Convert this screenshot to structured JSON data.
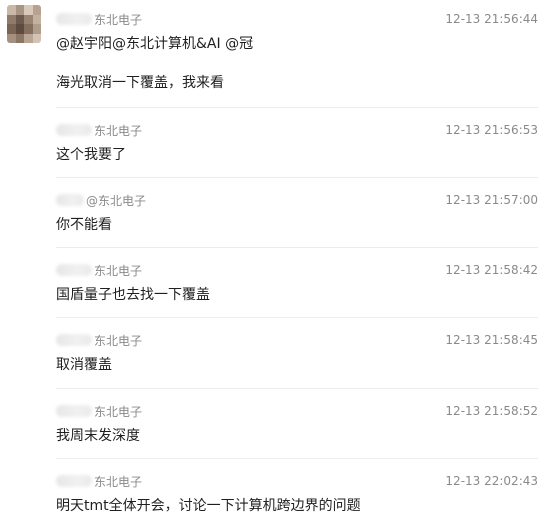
{
  "messages": [
    {
      "sender_suffix": "东北电子",
      "time": "12-13 21:56:44",
      "lines": [
        "@赵宇阳@东北计算机&AI @冠",
        "海光取消一下覆盖，我来看"
      ]
    },
    {
      "sender_suffix": "东北电子",
      "time": "12-13 21:56:53",
      "lines": [
        "这个我要了"
      ]
    },
    {
      "sender_suffix": "@东北电子",
      "time": "12-13 21:57:00",
      "lines": [
        "你不能看"
      ]
    },
    {
      "sender_suffix": "东北电子",
      "time": "12-13 21:58:42",
      "lines": [
        "国盾量子也去找一下覆盖"
      ]
    },
    {
      "sender_suffix": "东北电子",
      "time": "12-13 21:58:45",
      "lines": [
        "取消覆盖"
      ]
    },
    {
      "sender_suffix": "东北电子",
      "time": "12-13 21:58:52",
      "lines": [
        "我周末发深度"
      ]
    },
    {
      "sender_suffix": "东北电子",
      "time": "12-13 22:02:43",
      "lines": [
        "明天tmt全体开会，讨论一下计算机跨边界的问题"
      ]
    }
  ]
}
